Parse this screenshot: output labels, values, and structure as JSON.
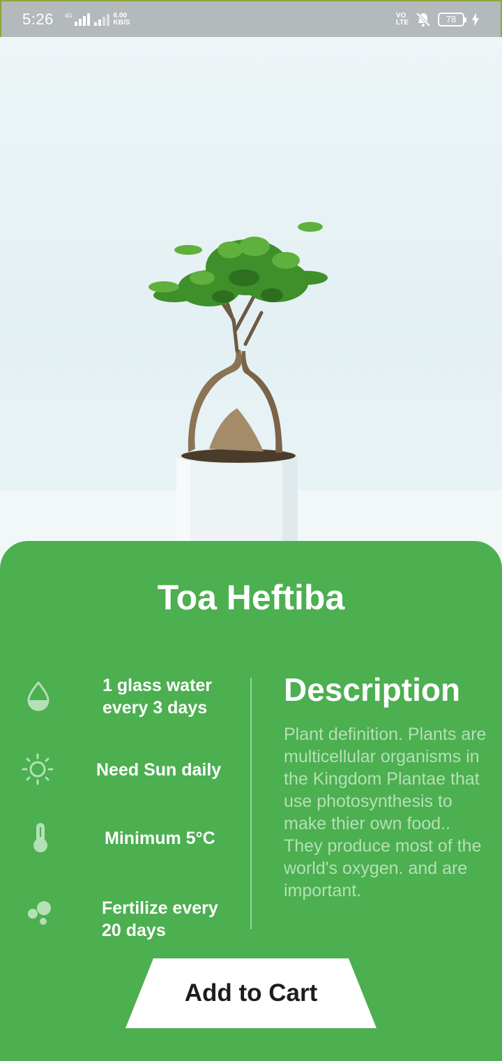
{
  "status_bar": {
    "time": "5:26",
    "network": "4G",
    "speed_value": "6.00",
    "speed_unit": "KB/S",
    "volte_top": "VO",
    "volte_bottom": "LTE",
    "battery": "78"
  },
  "plant": {
    "name": "Toa Heftiba"
  },
  "care": [
    {
      "icon": "water-drop-icon",
      "text": "1 glass water every 3 days"
    },
    {
      "icon": "sun-icon",
      "text": "Need Sun daily"
    },
    {
      "icon": "thermometer-icon",
      "text": "Minimum 5°C"
    },
    {
      "icon": "fertilizer-icon",
      "text": "Fertilize every 20 days"
    }
  ],
  "description": {
    "title": "Description",
    "body": "Plant definition. Plants are multicellular organisms in the Kingdom Plantae that use photosynthesis to make thier own food.. They produce most of the world's oxygen. and are important."
  },
  "actions": {
    "add_to_cart": "Add to Cart"
  },
  "colors": {
    "card_green": "#4caf50",
    "description_text": "#b4e0b6",
    "button_bg": "#ffffff"
  }
}
